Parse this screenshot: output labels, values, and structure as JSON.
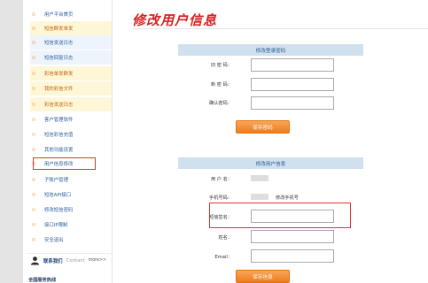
{
  "sidebar": {
    "items": [
      {
        "label": "用户平台首页",
        "state": "normal"
      },
      {
        "label": "短信群发单发",
        "state": "highlight"
      },
      {
        "label": "短信发送日志",
        "state": "active"
      },
      {
        "label": "短信回复日志",
        "state": "active"
      },
      {
        "label": "彩信单发群发",
        "state": "highlight"
      },
      {
        "label": "我的彩信文件",
        "state": "active"
      },
      {
        "label": "彩信发送日志",
        "state": "active"
      },
      {
        "label": "客户管理软件",
        "state": "normal"
      },
      {
        "label": "短信彩信充值",
        "state": "normal"
      },
      {
        "label": "其他功能设置",
        "state": "normal"
      },
      {
        "label": "用户信息修改",
        "state": "selected"
      },
      {
        "label": "子账户管理",
        "state": "normal"
      },
      {
        "label": "短信API接口",
        "state": "normal"
      },
      {
        "label": "修改短信密码",
        "state": "normal"
      },
      {
        "label": "接口IP限制",
        "state": "normal"
      },
      {
        "label": "安全退出",
        "state": "normal"
      }
    ],
    "contact": {
      "label_cn": "联系我们",
      "label_en": "Contact",
      "more": "more>>"
    },
    "bottom_text": "全国服务热线"
  },
  "main": {
    "title": "修改用户信息",
    "password_panel": {
      "heading": "修改登录密码",
      "old_password_label": "旧 密 码：",
      "new_password_label": "新 密 码：",
      "confirm_password_label": "确认密码：",
      "submit_label": "保存密码"
    },
    "info_panel": {
      "heading": "修改用户信息",
      "username_label": "用 户 名：",
      "phone_label": "手机号码：",
      "phone_action": "修改手机号",
      "signature_label": "短信签名：",
      "name_label": "姓名：",
      "email_label": "Email：",
      "submit_label": "保存信息"
    }
  },
  "colors": {
    "accent_red": "#d82121",
    "orange_button": "#ef7c1b",
    "panel_header": "#cfe0ef",
    "link_blue": "#2c5f9e"
  }
}
